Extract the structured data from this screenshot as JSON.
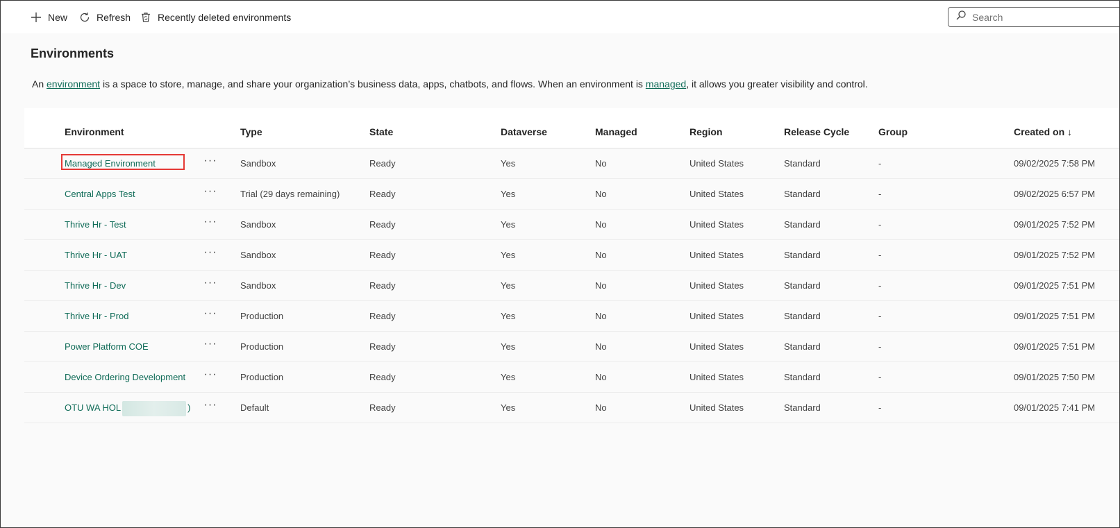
{
  "toolbar": {
    "new_label": "New",
    "refresh_label": "Refresh",
    "recently_deleted_label": "Recently deleted environments",
    "search_placeholder": "Search"
  },
  "page": {
    "title": "Environments",
    "description_prefix": "An ",
    "description_link1": "environment",
    "description_middle": " is a space to store, manage, and share your organization’s business data, apps, chatbots, and flows. When an environment is ",
    "description_link2": "managed",
    "description_suffix": ", it allows you greater visibility and control."
  },
  "table": {
    "columns": {
      "environment": "Environment",
      "type": "Type",
      "state": "State",
      "dataverse": "Dataverse",
      "managed": "Managed",
      "region": "Region",
      "release_cycle": "Release Cycle",
      "group": "Group",
      "created_on": "Created on ↓"
    },
    "more_glyph": "···",
    "rows": [
      {
        "environment": "Managed Environment",
        "type": "Sandbox",
        "state": "Ready",
        "dataverse": "Yes",
        "managed": "No",
        "region": "United States",
        "release_cycle": "Standard",
        "group": "-",
        "created_on": "09/02/2025 7:58 PM"
      },
      {
        "environment": "Central Apps Test",
        "type": "Trial (29 days remaining)",
        "state": "Ready",
        "dataverse": "Yes",
        "managed": "No",
        "region": "United States",
        "release_cycle": "Standard",
        "group": "-",
        "created_on": "09/02/2025 6:57 PM"
      },
      {
        "environment": "Thrive Hr - Test",
        "type": "Sandbox",
        "state": "Ready",
        "dataverse": "Yes",
        "managed": "No",
        "region": "United States",
        "release_cycle": "Standard",
        "group": "-",
        "created_on": "09/01/2025 7:52 PM"
      },
      {
        "environment": "Thrive Hr - UAT",
        "type": "Sandbox",
        "state": "Ready",
        "dataverse": "Yes",
        "managed": "No",
        "region": "United States",
        "release_cycle": "Standard",
        "group": "-",
        "created_on": "09/01/2025 7:52 PM"
      },
      {
        "environment": "Thrive Hr - Dev",
        "type": "Sandbox",
        "state": "Ready",
        "dataverse": "Yes",
        "managed": "No",
        "region": "United States",
        "release_cycle": "Standard",
        "group": "-",
        "created_on": "09/01/2025 7:51 PM"
      },
      {
        "environment": "Thrive Hr - Prod",
        "type": "Production",
        "state": "Ready",
        "dataverse": "Yes",
        "managed": "No",
        "region": "United States",
        "release_cycle": "Standard",
        "group": "-",
        "created_on": "09/01/2025 7:51 PM"
      },
      {
        "environment": "Power Platform COE",
        "type": "Production",
        "state": "Ready",
        "dataverse": "Yes",
        "managed": "No",
        "region": "United States",
        "release_cycle": "Standard",
        "group": "-",
        "created_on": "09/01/2025 7:51 PM"
      },
      {
        "environment": "Device Ordering Development",
        "type": "Production",
        "state": "Ready",
        "dataverse": "Yes",
        "managed": "No",
        "region": "United States",
        "release_cycle": "Standard",
        "group": "-",
        "created_on": "09/01/2025 7:50 PM"
      },
      {
        "environment": "OTU WA HOL",
        "environment_suffix": ")",
        "type": "Default",
        "state": "Ready",
        "dataverse": "Yes",
        "managed": "No",
        "region": "United States",
        "release_cycle": "Standard",
        "group": "-",
        "created_on": "09/01/2025 7:41 PM"
      }
    ]
  },
  "colors": {
    "link": "#0f6b57",
    "highlight": "#e53935"
  }
}
